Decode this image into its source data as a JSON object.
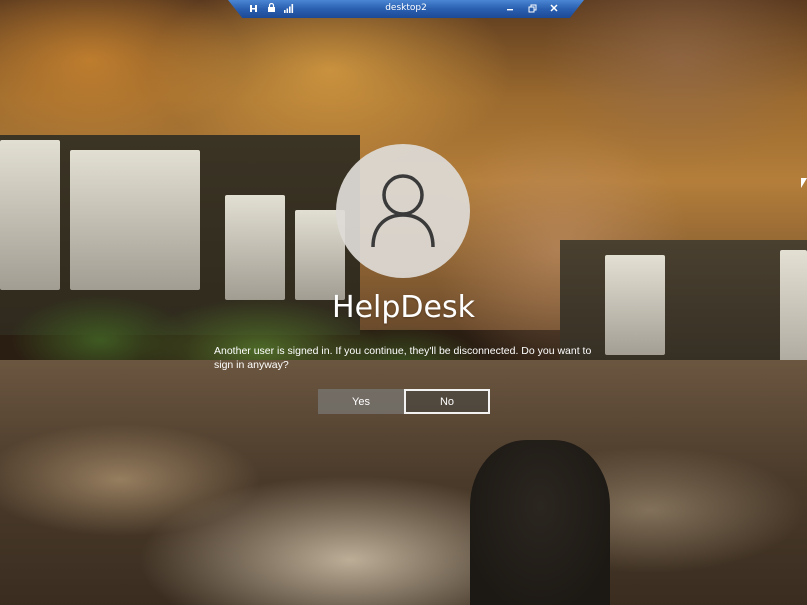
{
  "remote_bar": {
    "title": "desktop2",
    "left_icons": [
      "pin-icon",
      "lock-icon",
      "signal-icon"
    ],
    "right_controls": [
      "minimize-icon",
      "restore-icon",
      "close-icon"
    ]
  },
  "login": {
    "username": "HelpDesk",
    "message": "Another user is signed in. If you continue, they'll be disconnected. Do you want to sign in anyway?",
    "yes_label": "Yes",
    "no_label": "No"
  },
  "colors": {
    "rdp_bar": "#2a5fb0",
    "avatar_bg": "#dedad6",
    "text": "#ffffff"
  }
}
